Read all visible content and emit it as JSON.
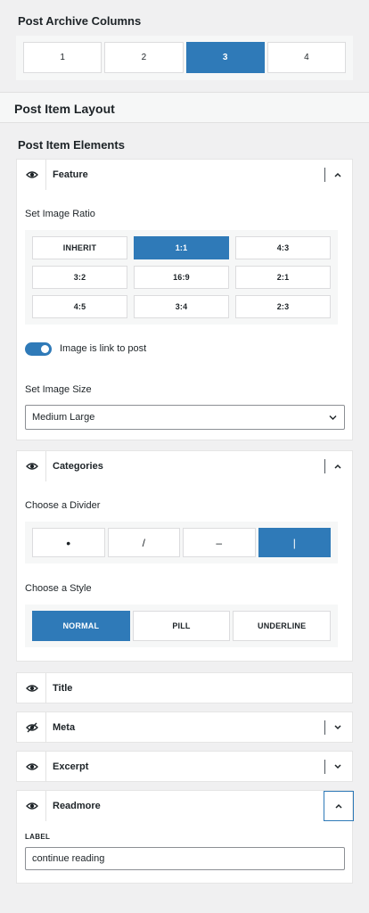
{
  "archive_columns": {
    "title": "Post Archive Columns",
    "options": [
      "1",
      "2",
      "3",
      "4"
    ],
    "selected": "3"
  },
  "layout_bar": {
    "title": "Post Item Layout"
  },
  "elements_title": "Post Item Elements",
  "feature": {
    "title": "Feature",
    "ratio_label": "Set Image Ratio",
    "ratios": [
      "INHERIT",
      "1:1",
      "4:3",
      "3:2",
      "16:9",
      "2:1",
      "4:5",
      "3:4",
      "2:3"
    ],
    "selected_ratio": "1:1",
    "link_toggle_label": "Image is link to post",
    "link_toggle_on": true,
    "size_label": "Set Image Size",
    "size_value": "Medium Large"
  },
  "categories": {
    "title": "Categories",
    "divider_label": "Choose a Divider",
    "dividers": [
      "•",
      "/",
      "–",
      "|"
    ],
    "selected_divider": "|",
    "style_label": "Choose a Style",
    "styles": [
      "NORMAL",
      "PILL",
      "UNDERLINE"
    ],
    "selected_style": "NORMAL"
  },
  "title_panel": {
    "title": "Title"
  },
  "meta_panel": {
    "title": "Meta"
  },
  "excerpt_panel": {
    "title": "Excerpt"
  },
  "readmore": {
    "title": "Readmore",
    "label_caption": "LABEL",
    "label_value": "continue reading"
  },
  "colors": {
    "accent": "#2f7ab8",
    "panel_bg": "#ffffff",
    "page_bg": "#f0f0f1"
  },
  "icons": {
    "visible": "eye-icon",
    "hidden": "eye-slash-icon",
    "collapse": "chevron-up-icon",
    "expand": "chevron-down-icon"
  }
}
